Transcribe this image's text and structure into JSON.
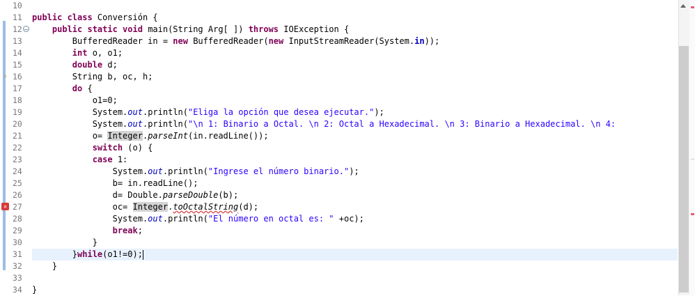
{
  "editor": {
    "line_numbers": [
      "10",
      "11",
      "12",
      "13",
      "14",
      "15",
      "16",
      "17",
      "18",
      "19",
      "20",
      "21",
      "22",
      "23",
      "24",
      "25",
      "26",
      "27",
      "28",
      "29",
      "30",
      "31",
      "32",
      "33",
      "34"
    ],
    "lines": [
      {
        "num": "10",
        "segments": []
      },
      {
        "num": "11",
        "segments": [
          {
            "t": "public class ",
            "c": "kw"
          },
          {
            "t": "Conversión {",
            "c": ""
          }
        ]
      },
      {
        "num": "12",
        "segments": [
          {
            "t": "    ",
            "c": ""
          },
          {
            "t": "public static void ",
            "c": "kw"
          },
          {
            "t": "main(String Arg[ ]) ",
            "c": ""
          },
          {
            "t": "throws ",
            "c": "kw"
          },
          {
            "t": "IOException {",
            "c": ""
          }
        ]
      },
      {
        "num": "13",
        "segments": [
          {
            "t": "        BufferedReader in = ",
            "c": ""
          },
          {
            "t": "new ",
            "c": "kw"
          },
          {
            "t": "BufferedReader(",
            "c": ""
          },
          {
            "t": "new ",
            "c": "kw"
          },
          {
            "t": "InputStreamReader(System.",
            "c": ""
          },
          {
            "t": "in",
            "c": "fld-b"
          },
          {
            "t": "));",
            "c": ""
          }
        ]
      },
      {
        "num": "14",
        "segments": [
          {
            "t": "        ",
            "c": ""
          },
          {
            "t": "int ",
            "c": "kw"
          },
          {
            "t": "o, o1;",
            "c": ""
          }
        ]
      },
      {
        "num": "15",
        "segments": [
          {
            "t": "        ",
            "c": ""
          },
          {
            "t": "double ",
            "c": "kw"
          },
          {
            "t": "d;",
            "c": ""
          }
        ]
      },
      {
        "num": "16",
        "segments": [
          {
            "t": "        String b, oc, h;",
            "c": ""
          }
        ]
      },
      {
        "num": "17",
        "segments": [
          {
            "t": "        ",
            "c": ""
          },
          {
            "t": "do ",
            "c": "kw"
          },
          {
            "t": "{",
            "c": ""
          }
        ]
      },
      {
        "num": "18",
        "segments": [
          {
            "t": "            o1=0;",
            "c": ""
          }
        ]
      },
      {
        "num": "19",
        "segments": [
          {
            "t": "            System.",
            "c": ""
          },
          {
            "t": "out",
            "c": "fld"
          },
          {
            "t": ".println(",
            "c": ""
          },
          {
            "t": "\"Eliga la opción que desea ejecutar.\"",
            "c": "str"
          },
          {
            "t": ");",
            "c": ""
          }
        ]
      },
      {
        "num": "20",
        "segments": [
          {
            "t": "            System.",
            "c": ""
          },
          {
            "t": "out",
            "c": "fld"
          },
          {
            "t": ".println(",
            "c": ""
          },
          {
            "t": "\"\\n 1: Binario a Octal. \\n 2: Octal a Hexadecimal. \\n 3: Binario a Hexadecimal. \\n 4:",
            "c": "str"
          }
        ]
      },
      {
        "num": "21",
        "segments": [
          {
            "t": "            o= ",
            "c": ""
          },
          {
            "t": "Integer",
            "c": "occ"
          },
          {
            "t": ".",
            "c": ""
          },
          {
            "t": "parseInt",
            "c": "ital"
          },
          {
            "t": "(in.readLine());",
            "c": ""
          }
        ]
      },
      {
        "num": "22",
        "segments": [
          {
            "t": "            ",
            "c": ""
          },
          {
            "t": "switch ",
            "c": "kw"
          },
          {
            "t": "(o) {",
            "c": ""
          }
        ]
      },
      {
        "num": "23",
        "segments": [
          {
            "t": "            ",
            "c": ""
          },
          {
            "t": "case ",
            "c": "kw"
          },
          {
            "t": "1:",
            "c": ""
          }
        ]
      },
      {
        "num": "24",
        "segments": [
          {
            "t": "                System.",
            "c": ""
          },
          {
            "t": "out",
            "c": "fld"
          },
          {
            "t": ".println(",
            "c": ""
          },
          {
            "t": "\"Ingrese el número binario.\"",
            "c": "str"
          },
          {
            "t": ");",
            "c": ""
          }
        ]
      },
      {
        "num": "25",
        "segments": [
          {
            "t": "                b= in.readLine();",
            "c": ""
          }
        ]
      },
      {
        "num": "26",
        "segments": [
          {
            "t": "                d= Double.",
            "c": ""
          },
          {
            "t": "parseDouble",
            "c": "ital"
          },
          {
            "t": "(b);",
            "c": ""
          }
        ]
      },
      {
        "num": "27",
        "segments": [
          {
            "t": "                oc= ",
            "c": ""
          },
          {
            "t": "Integer",
            "c": "occ"
          },
          {
            "t": ".",
            "c": ""
          },
          {
            "t": "toOctalString",
            "c": "ital squiggle"
          },
          {
            "t": "(d);",
            "c": ""
          }
        ]
      },
      {
        "num": "28",
        "segments": [
          {
            "t": "                System.",
            "c": ""
          },
          {
            "t": "out",
            "c": "fld"
          },
          {
            "t": ".println(",
            "c": ""
          },
          {
            "t": "\"El número en octal es: \"",
            "c": "str"
          },
          {
            "t": " +oc);",
            "c": ""
          }
        ]
      },
      {
        "num": "29",
        "segments": [
          {
            "t": "                ",
            "c": ""
          },
          {
            "t": "break",
            "c": "kw"
          },
          {
            "t": ";",
            "c": ""
          }
        ]
      },
      {
        "num": "30",
        "segments": [
          {
            "t": "            }",
            "c": ""
          }
        ]
      },
      {
        "num": "31",
        "segments": [
          {
            "t": "        }",
            "c": ""
          },
          {
            "t": "while",
            "c": "kw"
          },
          {
            "t": "(o1!=0);",
            "c": ""
          }
        ],
        "current": true
      },
      {
        "num": "32",
        "segments": [
          {
            "t": "    }",
            "c": ""
          }
        ]
      },
      {
        "num": "33",
        "segments": []
      },
      {
        "num": "34",
        "segments": [
          {
            "t": "}",
            "c": ""
          }
        ]
      }
    ]
  },
  "markers": {
    "fold_line": "12",
    "warning_line": "16",
    "warning_icon": "warning-icon",
    "error_line": "27",
    "error_icon": "error-icon"
  },
  "colors": {
    "keyword": "#7f0055",
    "string": "#2a00ff",
    "field": "#0000c0",
    "current_line": "#e8f2fe",
    "occurrence": "#d4d4d4",
    "change_bar": "#9bbce8"
  }
}
